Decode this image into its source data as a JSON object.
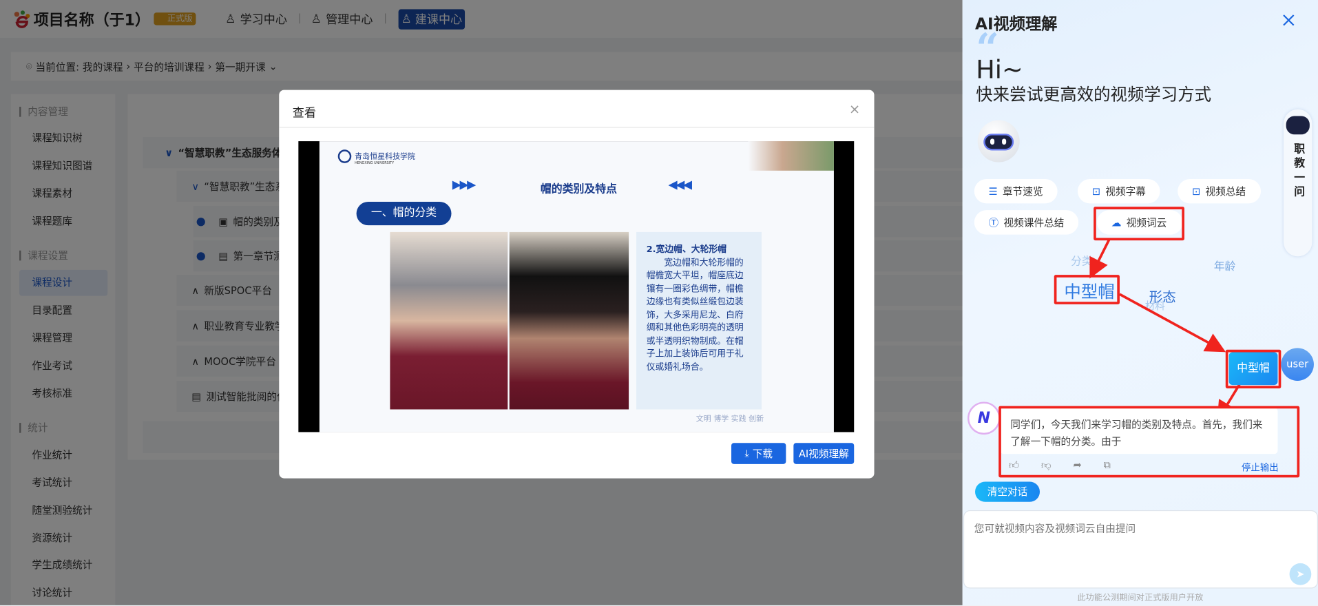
{
  "header": {
    "title": "项目名称（于1）",
    "badge": "正式版",
    "nav": [
      {
        "label": "学习中心",
        "icon": "graduate-icon"
      },
      {
        "label": "管理中心",
        "icon": "user-gear-icon"
      },
      {
        "label": "建课中心",
        "icon": "user-edit-icon",
        "active": true
      }
    ]
  },
  "breadcrumb": {
    "prefix": "当前位置:",
    "items": [
      "我的课程",
      "平台的培训课程",
      "第一期开课"
    ]
  },
  "sidebar": {
    "sections": [
      {
        "title": "内容管理",
        "items": [
          "课程知识树",
          "课程知识图谱",
          "课程素材",
          "课程题库"
        ]
      },
      {
        "title": "课程设置",
        "items": [
          "课程设计",
          "目录配置",
          "课程管理",
          "作业考试",
          "考核标准"
        ]
      },
      {
        "title": "统计",
        "items": [
          "作业统计",
          "考试统计",
          "随堂测验统计",
          "资源统计",
          "学生成绩统计",
          "讨论统计"
        ]
      }
    ],
    "active": "课程设计"
  },
  "tree": [
    "“智慧职教”生态服务体系",
    "“智慧职教”生态系",
    "帽的类别及",
    "第一章节测",
    "新版SPOC平台",
    "职业教育专业教学",
    "MOOC学院平台",
    "测试智能批阅的作"
  ],
  "modal": {
    "title": "查看",
    "download": "下载",
    "ai_button": "AI视频理解",
    "slide": {
      "school": "青岛恒星科技学院",
      "school_en": "HENGXING   UNIVERSITY",
      "heading": "帽的类别及特点",
      "section": "一、帽的分类",
      "text_title": "2.宽边帽、大轮形帽",
      "text_body": "宽边帽和大轮形帽的帽檐宽大平坦，帽座底边镶有一圈彩色绸带，帽檐边缘也有类似丝缎包边装饰，大多采用尼龙、白府绸和其他色彩明亮的透明或半透明织物制成。在帽子上加上装饰后可用于礼仪或婚礼场合。",
      "motto": "文明 博学 实践 创新"
    }
  },
  "ai_panel": {
    "title": "AI视频理解",
    "hi": "Hi~",
    "subtitle": "快来尝试更高效的视频学习方式",
    "float": "职教一问",
    "chips": [
      {
        "label": "章节速览",
        "icon": "list-icon"
      },
      {
        "label": "视频字幕",
        "icon": "video-subtitle-icon"
      },
      {
        "label": "视频总结",
        "icon": "video-summary-icon"
      },
      {
        "label": "视频课件总结",
        "icon": "text-icon"
      },
      {
        "label": "视频词云",
        "icon": "cloud-icon"
      }
    ],
    "wordcloud": [
      "分类",
      "年龄",
      "中型帽",
      "形态",
      "材料"
    ],
    "user_msg": "中型帽",
    "user_label": "user",
    "ai_msg": "同学们，今天我们来学习帽的类别及特点。首先，我们来了解一下帽的分类。由于",
    "stop": "停止输出",
    "clear": "清空对话",
    "input_placeholder": "您可就视频内容及视频词云自由提问",
    "footer": "此功能公测期间对正式版用户开放"
  },
  "colors": {
    "primary": "#1a66e0",
    "nav_active": "#1a4ba8",
    "annotation": "#f0231e"
  }
}
